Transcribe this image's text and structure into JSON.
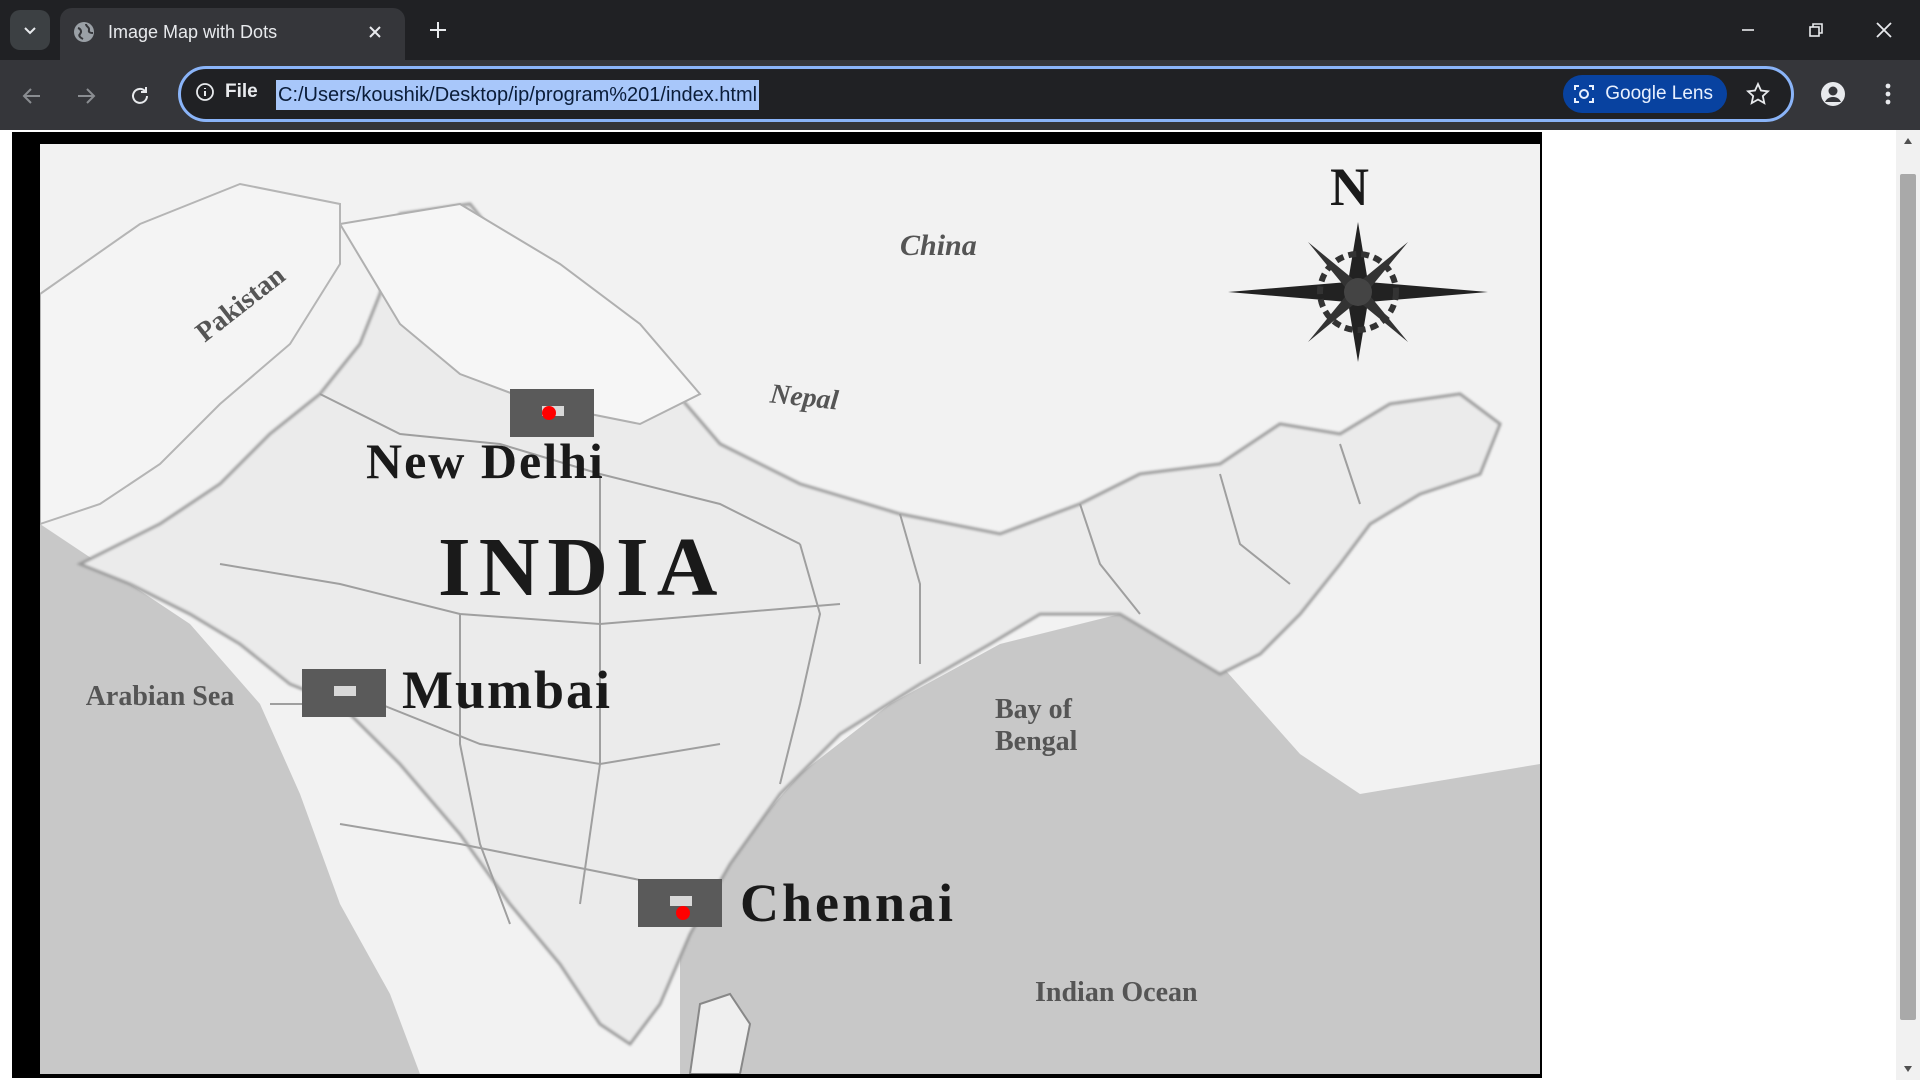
{
  "browser": {
    "tab_title": "Image Map with Dots",
    "omnibox": {
      "scheme_label": "File",
      "url": "C:/Users/koushik/Desktop/ip/program%201/index.html",
      "lens_label": "Google Lens"
    }
  },
  "map": {
    "labels": {
      "china": "China",
      "pakistan": "Pakistan",
      "nepal": "Nepal",
      "new_delhi": "New Delhi",
      "india": "INDIA",
      "mumbai": "Mumbai",
      "arabian_sea": "Arabian Sea",
      "bay_of_bengal": "Bay of Bengal",
      "chennai": "Chennai",
      "indian_ocean": "Indian Ocean",
      "compass_north": "N"
    },
    "marker_color": "#ff0000",
    "sea_color": "#c8c8c8",
    "land_color": "#ececec"
  }
}
